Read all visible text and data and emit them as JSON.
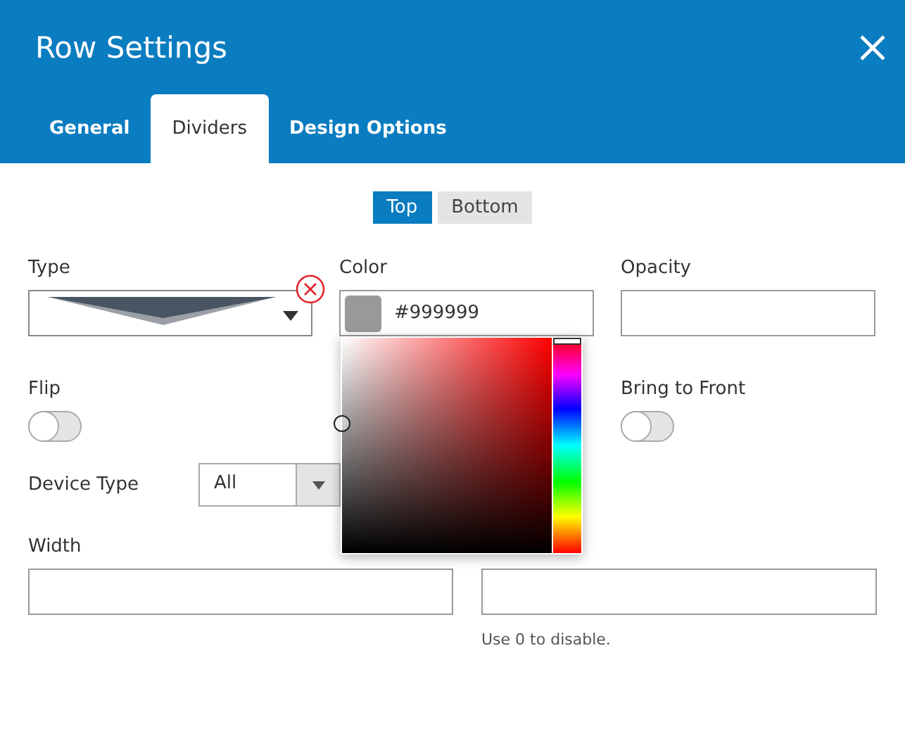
{
  "window": {
    "title": "Row Settings"
  },
  "tabs": [
    {
      "label": "General",
      "selected": false
    },
    {
      "label": "Dividers",
      "selected": true
    },
    {
      "label": "Design Options",
      "selected": false
    }
  ],
  "position": [
    {
      "label": "Top",
      "selected": true
    },
    {
      "label": "Bottom",
      "selected": false
    }
  ],
  "type": {
    "label": "Type"
  },
  "color": {
    "label": "Color",
    "value": "#999999",
    "picker_open": true
  },
  "opacity": {
    "label": "Opacity"
  },
  "flip": {
    "label": "Flip",
    "checked": false
  },
  "bring_to_front": {
    "label": "Bring to Front",
    "checked": false
  },
  "device_type": {
    "label": "Device Type",
    "value": "All"
  },
  "width": {
    "label": "Width"
  },
  "height": {
    "hint": "Use 0 to disable."
  }
}
